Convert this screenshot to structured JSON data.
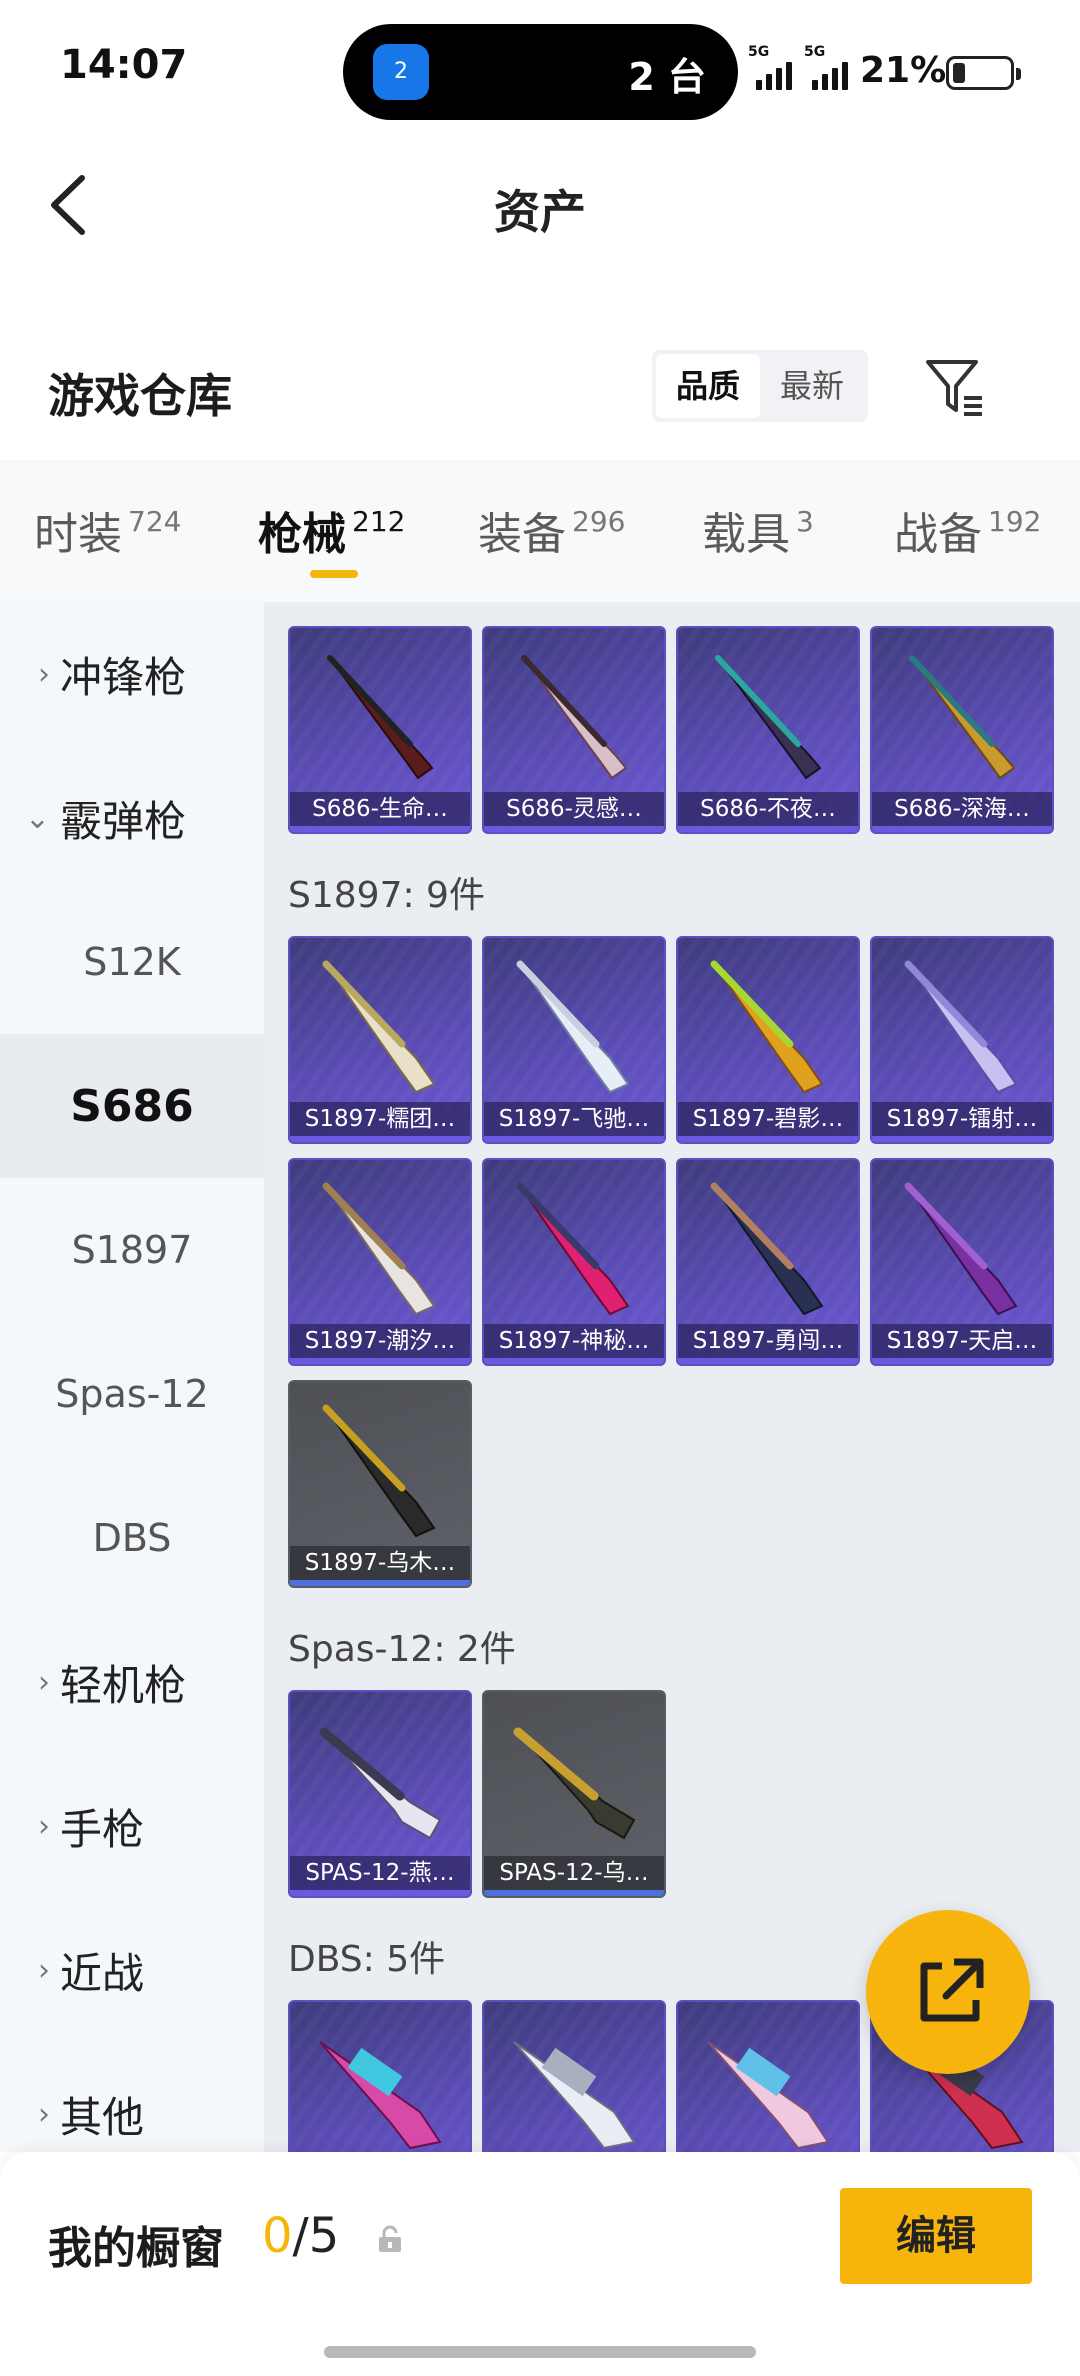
{
  "status_bar": {
    "time": "14:07",
    "island_icon_text": "2",
    "island_text": "2 台",
    "signal1_tag": "5G",
    "signal2_tag": "5G",
    "battery_text": "21%",
    "battery_level": 0.21
  },
  "header": {
    "title": "资产"
  },
  "warehouse": {
    "title": "游戏仓库",
    "sort_options": [
      {
        "label": "品质",
        "active": true
      },
      {
        "label": "最新",
        "active": false
      }
    ]
  },
  "tabs": [
    {
      "label": "时装",
      "count": "724",
      "active": false
    },
    {
      "label": "枪械",
      "count": "212",
      "active": true
    },
    {
      "label": "装备",
      "count": "296",
      "active": false
    },
    {
      "label": "载具",
      "count": "3",
      "active": false
    },
    {
      "label": "战备",
      "count": "192",
      "active": false
    }
  ],
  "sidebar": {
    "items": [
      {
        "label": "冲锋枪",
        "chevron": "›",
        "type": "category"
      },
      {
        "label": "霰弹枪",
        "chevron": "⌄",
        "type": "category"
      },
      {
        "label": "S12K",
        "type": "child"
      },
      {
        "label": "S686",
        "type": "child",
        "selected": true
      },
      {
        "label": "S1897",
        "type": "child"
      },
      {
        "label": "Spas-12",
        "type": "child"
      },
      {
        "label": "DBS",
        "type": "child"
      },
      {
        "label": "轻机枪",
        "chevron": "›",
        "type": "category"
      },
      {
        "label": "手枪",
        "chevron": "›",
        "type": "category"
      },
      {
        "label": "近战",
        "chevron": "›",
        "type": "category"
      },
      {
        "label": "其他",
        "chevron": "›",
        "type": "category"
      }
    ]
  },
  "groups": {
    "s686": {
      "items": [
        {
          "label": "S686-生命…",
          "rarity": "purple"
        },
        {
          "label": "S686-灵感…",
          "rarity": "purple"
        },
        {
          "label": "S686-不夜…",
          "rarity": "purple"
        },
        {
          "label": "S686-深海…",
          "rarity": "purple"
        }
      ]
    },
    "s1897": {
      "title": "S1897: 9件",
      "items": [
        {
          "label": "S1897-糯团…",
          "rarity": "purple"
        },
        {
          "label": "S1897-飞驰…",
          "rarity": "purple"
        },
        {
          "label": "S1897-碧影…",
          "rarity": "purple"
        },
        {
          "label": "S1897-镭射…",
          "rarity": "purple"
        },
        {
          "label": "S1897-潮汐…",
          "rarity": "purple"
        },
        {
          "label": "S1897-神秘…",
          "rarity": "purple"
        },
        {
          "label": "S1897-勇闯…",
          "rarity": "purple"
        },
        {
          "label": "S1897-天启…",
          "rarity": "purple"
        },
        {
          "label": "S1897-乌木…",
          "rarity": "grey"
        }
      ]
    },
    "spas12": {
      "title": "Spas-12: 2件",
      "items": [
        {
          "label": "SPAS-12-燕…",
          "rarity": "purple"
        },
        {
          "label": "SPAS-12-乌…",
          "rarity": "grey"
        }
      ]
    },
    "dbs": {
      "title": "DBS: 5件",
      "items": [
        {
          "label": "",
          "rarity": "purple"
        },
        {
          "label": "",
          "rarity": "purple"
        },
        {
          "label": "",
          "rarity": "purple"
        },
        {
          "label": "",
          "rarity": "purple"
        }
      ]
    }
  },
  "showcase": {
    "label": "我的橱窗",
    "current": "0",
    "separator": "/",
    "max": "5",
    "edit_label": "编辑"
  },
  "colors": {
    "accent": "#f5b60a",
    "rarity_purple": "#5a4bb3",
    "rarity_grey": "#5f6168"
  },
  "icons": {
    "back": "back-arrow-icon",
    "filter": "filter-icon",
    "share": "share-external-icon",
    "lock": "lock-icon"
  }
}
